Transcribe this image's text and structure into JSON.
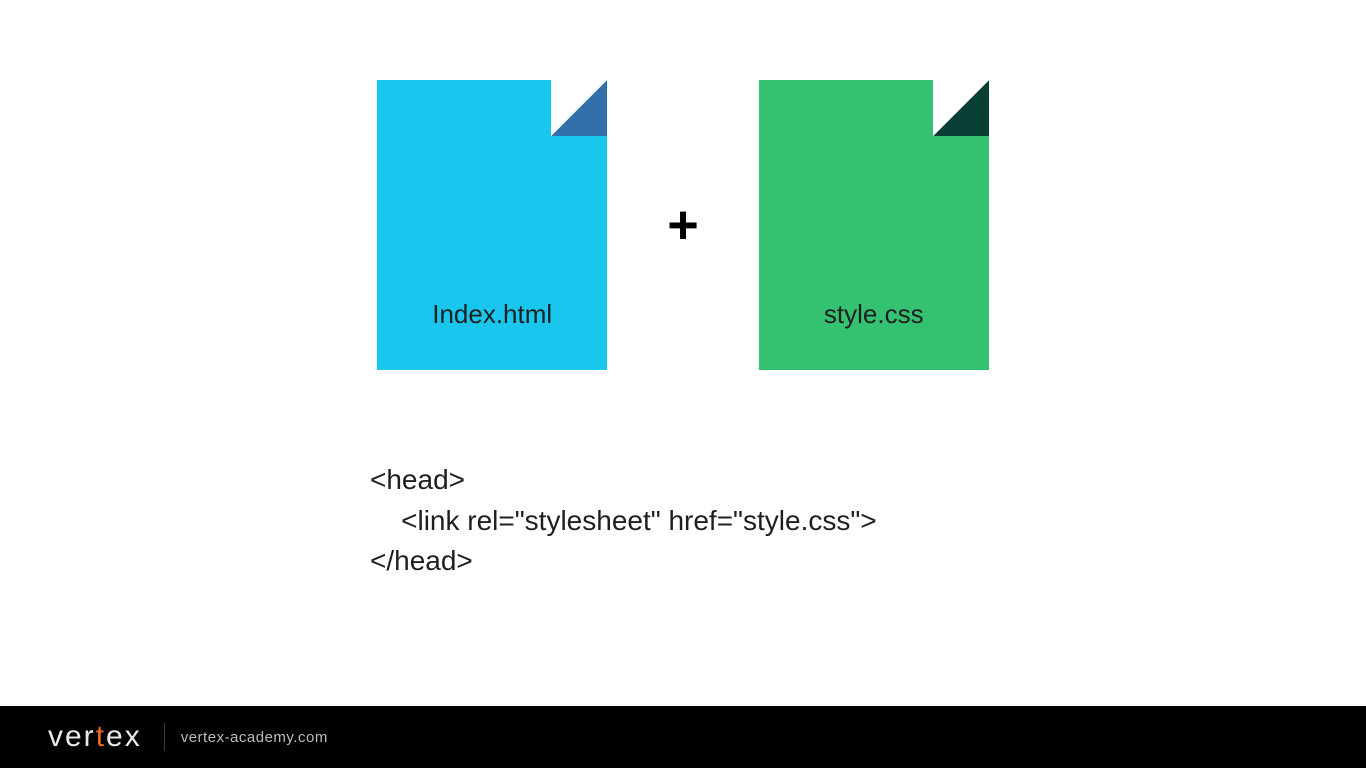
{
  "files": {
    "left": {
      "label": "Index.html"
    },
    "right": {
      "label": "style.css"
    },
    "join_symbol": "+"
  },
  "code": {
    "line1": "<head>",
    "line2": "    <link rel=\"stylesheet\" href=\"style.css\">",
    "line3": "</head>"
  },
  "footer": {
    "logo_pre": "ver",
    "logo_accent": "t",
    "logo_post": "ex",
    "subtitle": "vertex-academy.com"
  },
  "colors": {
    "file_blue": "#18c6ee",
    "file_blue_fold": "#316fab",
    "file_green": "#34c172",
    "file_green_fold": "#083e34",
    "footer_bg": "#000000",
    "accent": "#e86a24"
  }
}
